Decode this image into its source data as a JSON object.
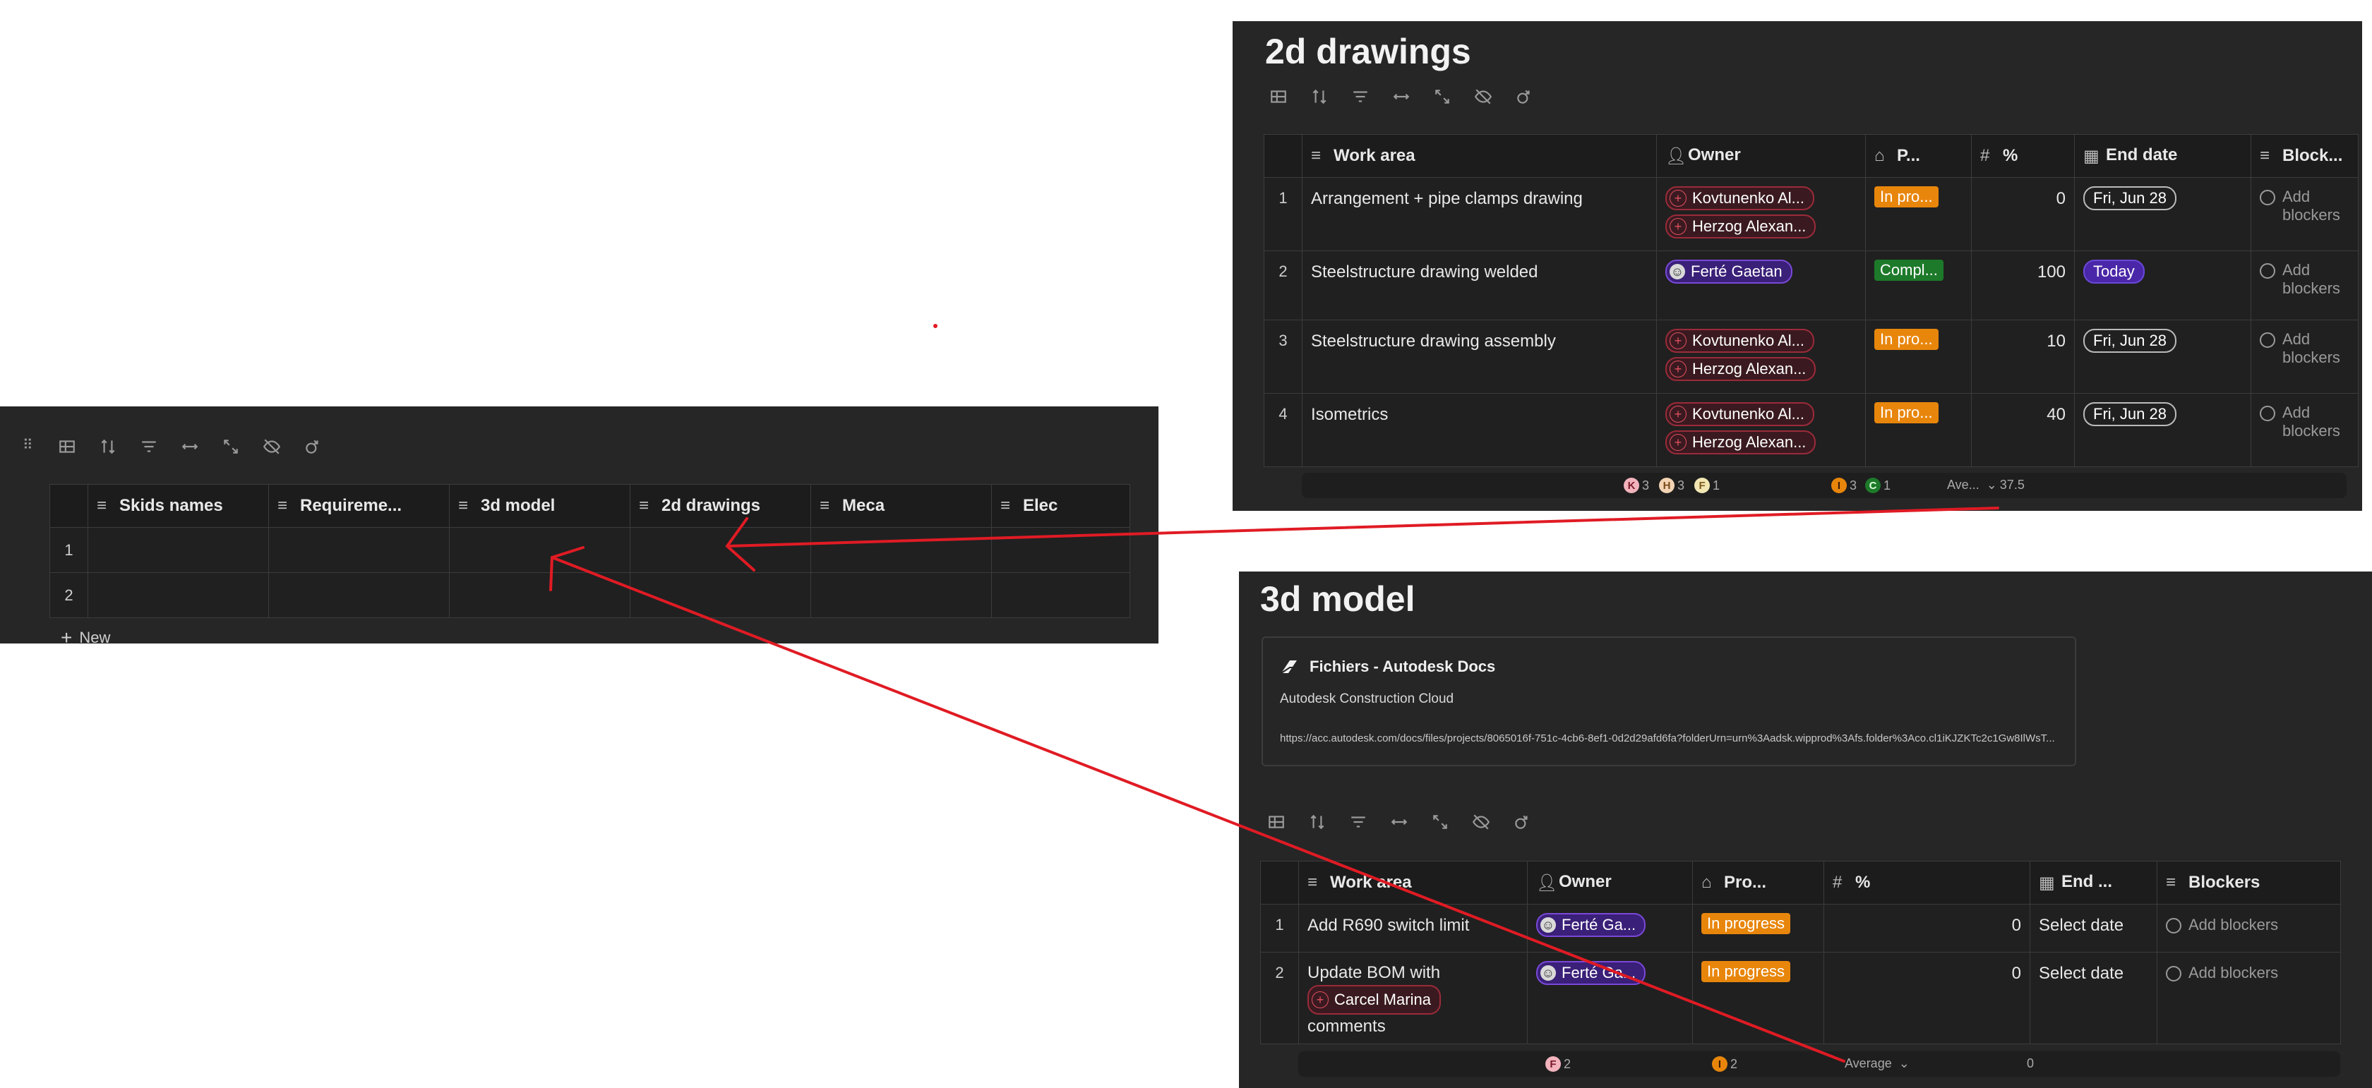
{
  "left_table": {
    "columns": [
      "Skids names",
      "Requireme...",
      "3d model",
      "2d drawings",
      "Meca",
      "Elec"
    ],
    "rows": [
      "1",
      "2"
    ],
    "new_label": "New"
  },
  "drawings": {
    "title": "2d drawings",
    "columns": [
      "Work area",
      "Owner",
      "P...",
      "%",
      "End date",
      "Block..."
    ],
    "rows": [
      {
        "n": "1",
        "work": "Arrangement + pipe clamps drawing",
        "owners": [
          "Kovtunenko Al...",
          "Herzog Alexan..."
        ],
        "status": "In pro...",
        "pct": "0",
        "date": "Fri, Jun 28",
        "blockers": "Add blockers"
      },
      {
        "n": "2",
        "work": "Steelstructure drawing welded",
        "owners": [
          "Ferté Gaetan"
        ],
        "status": "Compl...",
        "pct": "100",
        "date": "Today",
        "blockers": "Add blockers"
      },
      {
        "n": "3",
        "work": "Steelstructure drawing assembly",
        "owners": [
          "Kovtunenko Al...",
          "Herzog Alexan..."
        ],
        "status": "In pro...",
        "pct": "10",
        "date": "Fri, Jun 28",
        "blockers": "Add blockers"
      },
      {
        "n": "4",
        "work": "Isometrics",
        "owners": [
          "Kovtunenko Al...",
          "Herzog Alexan..."
        ],
        "status": "In pro...",
        "pct": "40",
        "date": "Fri, Jun 28",
        "blockers": "Add blockers"
      }
    ],
    "summary": {
      "owner_k": "K",
      "owner_k_count": "3",
      "owner_h": "H",
      "owner_h_count": "3",
      "owner_f": "F",
      "owner_f_count": "1",
      "status_i": "I",
      "status_i_count": "3",
      "status_c": "C",
      "status_c_count": "1",
      "pct_label": "Ave...",
      "pct_value": "37.5"
    }
  },
  "model": {
    "title": "3d model",
    "card": {
      "title": "Fichiers - Autodesk Docs",
      "subtitle": "Autodesk Construction Cloud",
      "url": "https://acc.autodesk.com/docs/files/projects/8065016f-751c-4cb6-8ef1-0d2d29afd6fa?folderUrn=urn%3Aadsk.wipprod%3Afs.folder%3Aco.cl1iKJZKTc2c1Gw8IlWsT..."
    },
    "columns": [
      "Work area",
      "Owner",
      "Pro...",
      "%",
      "End ...",
      "Blockers"
    ],
    "rows": [
      {
        "n": "1",
        "work": "Add R690 switch limit",
        "mention": "",
        "work_after": "",
        "owner": "Ferté Ga...",
        "status": "In progress",
        "pct": "0",
        "date": "Select date",
        "blockers": "Add blockers"
      },
      {
        "n": "2",
        "work": "Update BOM with",
        "mention": "Carcel Marina",
        "work_after": "comments",
        "owner": "Ferté Ga...",
        "status": "In progress",
        "pct": "0",
        "date": "Select date",
        "blockers": "Add blockers"
      }
    ],
    "summary": {
      "owner_f": "F",
      "owner_f_count": "2",
      "status_i": "I",
      "status_i_count": "2",
      "pct_label": "Average",
      "pct_value": "0"
    }
  },
  "colors": {
    "annotation": "#e01b24",
    "progress": "#e8860c",
    "complete": "#1d7a2a",
    "person": "#4a27a8"
  }
}
